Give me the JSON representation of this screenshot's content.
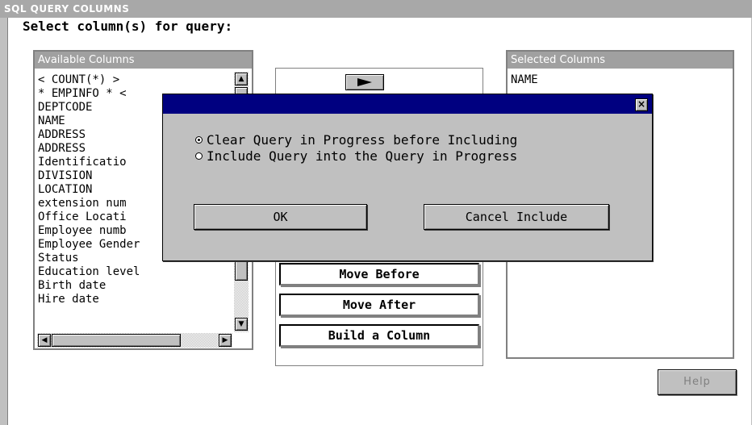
{
  "window": {
    "title": "SQL QUERY COLUMNS"
  },
  "prompt": "Select column(s) for query:",
  "available": {
    "header": "Available Columns",
    "items": [
      "< COUNT(*) >",
      "* EMPINFO * <",
      "DEPTCODE",
      "NAME",
      "ADDRESS",
      "ADDRESS",
      "Identificatio",
      "DIVISION",
      "LOCATION",
      "extension num",
      "Office Locati",
      "Employee numb",
      "Employee Gender",
      "Status",
      "Education level",
      "Birth date",
      "Hire date"
    ]
  },
  "selected": {
    "header": "Selected Columns",
    "items": [
      "NAME"
    ]
  },
  "buttons": {
    "move_before": "Move Before",
    "move_after": "Move After",
    "build_column": "Build a Column",
    "help": "Help"
  },
  "dialog": {
    "close_label": "×",
    "options": [
      {
        "label": "Clear Query in Progress before Including",
        "selected": true
      },
      {
        "label": "Include Query into the Query in Progress",
        "selected": false
      }
    ],
    "ok_label": "OK",
    "cancel_label": "Cancel Include"
  },
  "icons": {
    "up": "▲",
    "down": "▼",
    "left": "◀",
    "right": "▶"
  }
}
